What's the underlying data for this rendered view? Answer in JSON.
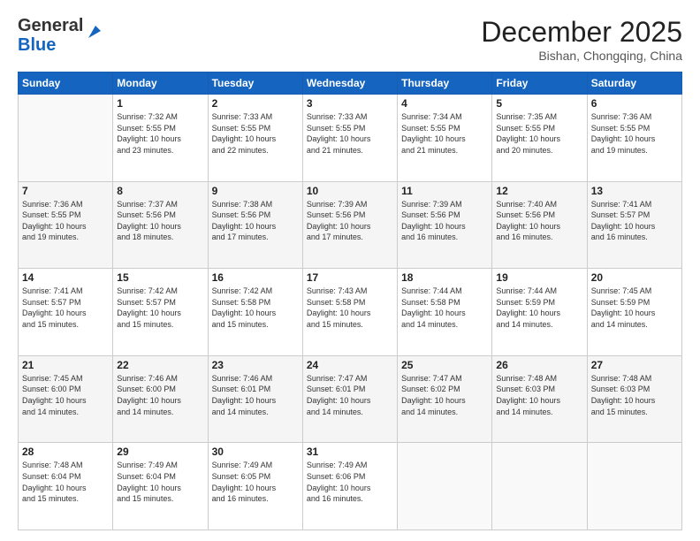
{
  "logo": {
    "line1": "General",
    "line2": "Blue"
  },
  "title": "December 2025",
  "subtitle": "Bishan, Chongqing, China",
  "weekdays": [
    "Sunday",
    "Monday",
    "Tuesday",
    "Wednesday",
    "Thursday",
    "Friday",
    "Saturday"
  ],
  "weeks": [
    [
      {
        "day": "",
        "info": ""
      },
      {
        "day": "1",
        "info": "Sunrise: 7:32 AM\nSunset: 5:55 PM\nDaylight: 10 hours\nand 23 minutes."
      },
      {
        "day": "2",
        "info": "Sunrise: 7:33 AM\nSunset: 5:55 PM\nDaylight: 10 hours\nand 22 minutes."
      },
      {
        "day": "3",
        "info": "Sunrise: 7:33 AM\nSunset: 5:55 PM\nDaylight: 10 hours\nand 21 minutes."
      },
      {
        "day": "4",
        "info": "Sunrise: 7:34 AM\nSunset: 5:55 PM\nDaylight: 10 hours\nand 21 minutes."
      },
      {
        "day": "5",
        "info": "Sunrise: 7:35 AM\nSunset: 5:55 PM\nDaylight: 10 hours\nand 20 minutes."
      },
      {
        "day": "6",
        "info": "Sunrise: 7:36 AM\nSunset: 5:55 PM\nDaylight: 10 hours\nand 19 minutes."
      }
    ],
    [
      {
        "day": "7",
        "info": "Sunrise: 7:36 AM\nSunset: 5:55 PM\nDaylight: 10 hours\nand 19 minutes."
      },
      {
        "day": "8",
        "info": "Sunrise: 7:37 AM\nSunset: 5:56 PM\nDaylight: 10 hours\nand 18 minutes."
      },
      {
        "day": "9",
        "info": "Sunrise: 7:38 AM\nSunset: 5:56 PM\nDaylight: 10 hours\nand 17 minutes."
      },
      {
        "day": "10",
        "info": "Sunrise: 7:39 AM\nSunset: 5:56 PM\nDaylight: 10 hours\nand 17 minutes."
      },
      {
        "day": "11",
        "info": "Sunrise: 7:39 AM\nSunset: 5:56 PM\nDaylight: 10 hours\nand 16 minutes."
      },
      {
        "day": "12",
        "info": "Sunrise: 7:40 AM\nSunset: 5:56 PM\nDaylight: 10 hours\nand 16 minutes."
      },
      {
        "day": "13",
        "info": "Sunrise: 7:41 AM\nSunset: 5:57 PM\nDaylight: 10 hours\nand 16 minutes."
      }
    ],
    [
      {
        "day": "14",
        "info": "Sunrise: 7:41 AM\nSunset: 5:57 PM\nDaylight: 10 hours\nand 15 minutes."
      },
      {
        "day": "15",
        "info": "Sunrise: 7:42 AM\nSunset: 5:57 PM\nDaylight: 10 hours\nand 15 minutes."
      },
      {
        "day": "16",
        "info": "Sunrise: 7:42 AM\nSunset: 5:58 PM\nDaylight: 10 hours\nand 15 minutes."
      },
      {
        "day": "17",
        "info": "Sunrise: 7:43 AM\nSunset: 5:58 PM\nDaylight: 10 hours\nand 15 minutes."
      },
      {
        "day": "18",
        "info": "Sunrise: 7:44 AM\nSunset: 5:58 PM\nDaylight: 10 hours\nand 14 minutes."
      },
      {
        "day": "19",
        "info": "Sunrise: 7:44 AM\nSunset: 5:59 PM\nDaylight: 10 hours\nand 14 minutes."
      },
      {
        "day": "20",
        "info": "Sunrise: 7:45 AM\nSunset: 5:59 PM\nDaylight: 10 hours\nand 14 minutes."
      }
    ],
    [
      {
        "day": "21",
        "info": "Sunrise: 7:45 AM\nSunset: 6:00 PM\nDaylight: 10 hours\nand 14 minutes."
      },
      {
        "day": "22",
        "info": "Sunrise: 7:46 AM\nSunset: 6:00 PM\nDaylight: 10 hours\nand 14 minutes."
      },
      {
        "day": "23",
        "info": "Sunrise: 7:46 AM\nSunset: 6:01 PM\nDaylight: 10 hours\nand 14 minutes."
      },
      {
        "day": "24",
        "info": "Sunrise: 7:47 AM\nSunset: 6:01 PM\nDaylight: 10 hours\nand 14 minutes."
      },
      {
        "day": "25",
        "info": "Sunrise: 7:47 AM\nSunset: 6:02 PM\nDaylight: 10 hours\nand 14 minutes."
      },
      {
        "day": "26",
        "info": "Sunrise: 7:48 AM\nSunset: 6:03 PM\nDaylight: 10 hours\nand 14 minutes."
      },
      {
        "day": "27",
        "info": "Sunrise: 7:48 AM\nSunset: 6:03 PM\nDaylight: 10 hours\nand 15 minutes."
      }
    ],
    [
      {
        "day": "28",
        "info": "Sunrise: 7:48 AM\nSunset: 6:04 PM\nDaylight: 10 hours\nand 15 minutes."
      },
      {
        "day": "29",
        "info": "Sunrise: 7:49 AM\nSunset: 6:04 PM\nDaylight: 10 hours\nand 15 minutes."
      },
      {
        "day": "30",
        "info": "Sunrise: 7:49 AM\nSunset: 6:05 PM\nDaylight: 10 hours\nand 16 minutes."
      },
      {
        "day": "31",
        "info": "Sunrise: 7:49 AM\nSunset: 6:06 PM\nDaylight: 10 hours\nand 16 minutes."
      },
      {
        "day": "",
        "info": ""
      },
      {
        "day": "",
        "info": ""
      },
      {
        "day": "",
        "info": ""
      }
    ]
  ]
}
